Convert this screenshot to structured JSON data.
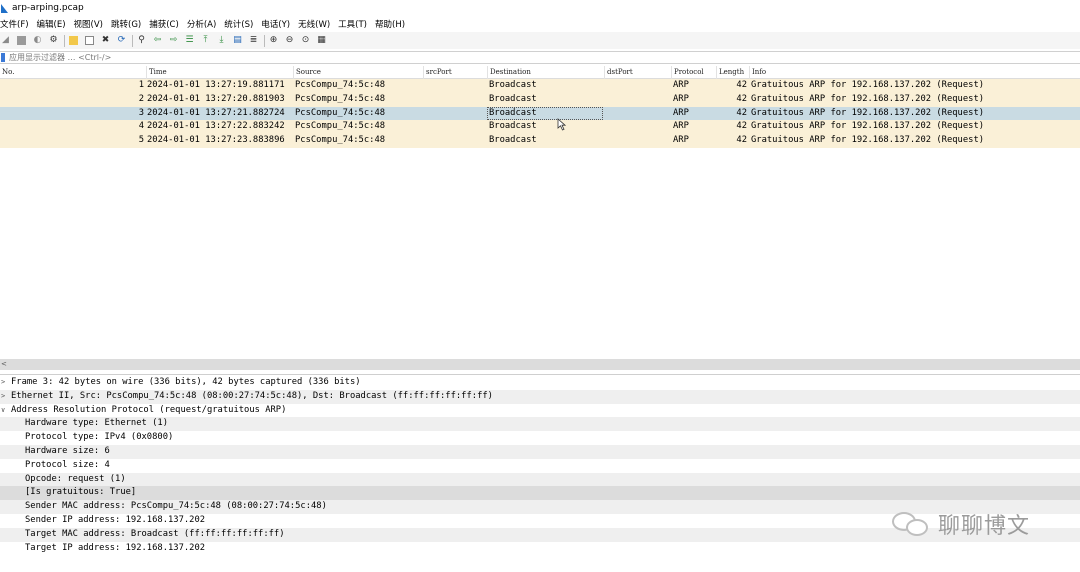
{
  "window": {
    "title": "arp-arping.pcap"
  },
  "menu": [
    "文件(F)",
    "编辑(E)",
    "视图(V)",
    "跳转(G)",
    "捕获(C)",
    "分析(A)",
    "统计(S)",
    "电话(Y)",
    "无线(W)",
    "工具(T)",
    "帮助(H)"
  ],
  "toolbar": {
    "icons": [
      "shark-fin-icon",
      "stop-icon",
      "restart-icon",
      "options-gear-icon",
      "open-file-icon",
      "save-file-icon",
      "close-file-icon",
      "reload-icon",
      "find-icon",
      "go-back-icon",
      "go-forward-icon",
      "go-to-packet-icon",
      "go-first-icon",
      "go-last-icon",
      "autoscroll-icon",
      "colorize-icon",
      "zoom-in-icon",
      "zoom-out-icon",
      "zoom-normal-icon",
      "resize-columns-icon"
    ]
  },
  "filter": {
    "placeholder": "应用显示过滤器 … <Ctrl-/>"
  },
  "packet_list": {
    "columns": [
      "No.",
      "Time",
      "Source",
      "srcPort",
      "Destination",
      "dstPort",
      "Protocol",
      "Length",
      "Info"
    ],
    "rows": [
      {
        "no": "1",
        "time": "2024-01-01 13:27:19.881171",
        "source": "PcsCompu_74:5c:48",
        "srcport": "",
        "destination": "Broadcast",
        "dstport": "",
        "protocol": "ARP",
        "length": "42",
        "info": "Gratuitous ARP for 192.168.137.202 (Request)"
      },
      {
        "no": "2",
        "time": "2024-01-01 13:27:20.881903",
        "source": "PcsCompu_74:5c:48",
        "srcport": "",
        "destination": "Broadcast",
        "dstport": "",
        "protocol": "ARP",
        "length": "42",
        "info": "Gratuitous ARP for 192.168.137.202 (Request)"
      },
      {
        "no": "3",
        "time": "2024-01-01 13:27:21.882724",
        "source": "PcsCompu_74:5c:48",
        "srcport": "",
        "destination": "Broadcast",
        "dstport": "",
        "protocol": "ARP",
        "length": "42",
        "info": "Gratuitous ARP for 192.168.137.202 (Request)"
      },
      {
        "no": "4",
        "time": "2024-01-01 13:27:22.883242",
        "source": "PcsCompu_74:5c:48",
        "srcport": "",
        "destination": "Broadcast",
        "dstport": "",
        "protocol": "ARP",
        "length": "42",
        "info": "Gratuitous ARP for 192.168.137.202 (Request)"
      },
      {
        "no": "5",
        "time": "2024-01-01 13:27:23.883896",
        "source": "PcsCompu_74:5c:48",
        "srcport": "",
        "destination": "Broadcast",
        "dstport": "",
        "protocol": "ARP",
        "length": "42",
        "info": "Gratuitous ARP for 192.168.137.202 (Request)"
      }
    ]
  },
  "details": [
    "Frame 3: 42 bytes on wire (336 bits), 42 bytes captured (336 bits)",
    "Ethernet II, Src: PcsCompu_74:5c:48 (08:00:27:74:5c:48), Dst: Broadcast (ff:ff:ff:ff:ff:ff)",
    "Address Resolution Protocol (request/gratuitous ARP)",
    "Hardware type: Ethernet (1)",
    "Protocol type: IPv4 (0x0800)",
    "Hardware size: 6",
    "Protocol size: 4",
    "Opcode: request (1)",
    "[Is gratuitous: True]",
    "Sender MAC address: PcsCompu_74:5c:48 (08:00:27:74:5c:48)",
    "Sender IP address: 192.168.137.202",
    "Target MAC address: Broadcast (ff:ff:ff:ff:ff:ff)",
    "Target IP address: 192.168.137.202"
  ],
  "watermark": {
    "text": "聊聊博文"
  },
  "colors": {
    "row_bg": "#faf0d7",
    "selected_row_bg": "#c9dbe3",
    "filter_marker": "#3b79d6"
  }
}
